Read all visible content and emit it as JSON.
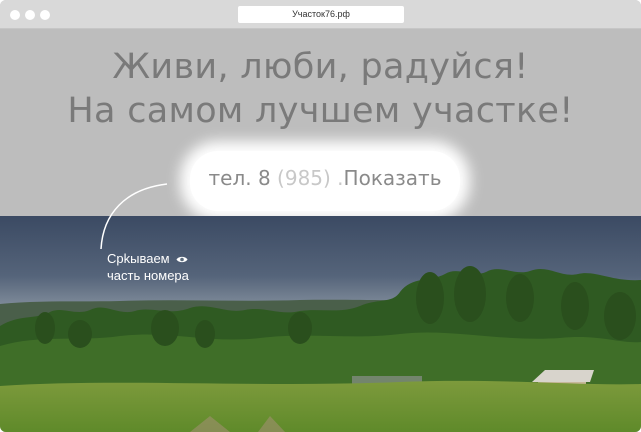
{
  "browser": {
    "url": "Участок76.рф"
  },
  "hero": {
    "line1": "Живи, люби, радуйся!",
    "line2": "На самом лучшем участке!"
  },
  "phone": {
    "prefix": "тел. 8 ",
    "hidden": "(985)",
    "dots": " .",
    "show_label": "Показать"
  },
  "annotation": {
    "line1": "Срkываем",
    "line2": "часть номера",
    "icon": "eye-icon"
  },
  "colors": {
    "overlay": "#bdbdbd",
    "sky": "#3f4f66",
    "text": "#7a7a7a"
  }
}
